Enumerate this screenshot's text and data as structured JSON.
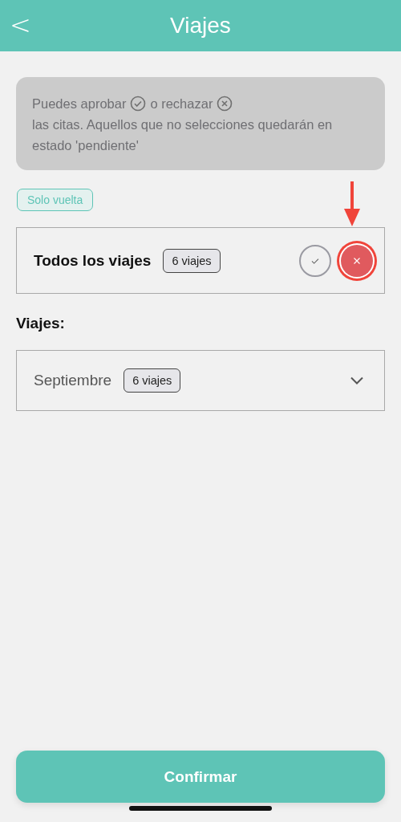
{
  "header": {
    "back_icon": "<",
    "title": "Viajes"
  },
  "info": {
    "part_1": "Puedes aprobar",
    "part_2": "o rechazar",
    "part_3": " las citas. Aquellos que no selecciones quedarán en estado 'pendiente'"
  },
  "tag": "Solo vuelta",
  "all_trips": {
    "label": "Todos los viajes",
    "count": "6 viajes",
    "approve_selected": false,
    "reject_selected": true
  },
  "section_title": "Viajes:",
  "months": [
    {
      "name": "Septiembre",
      "count": "6 viajes",
      "expanded": false
    }
  ],
  "confirm_button": "Confirmar"
}
